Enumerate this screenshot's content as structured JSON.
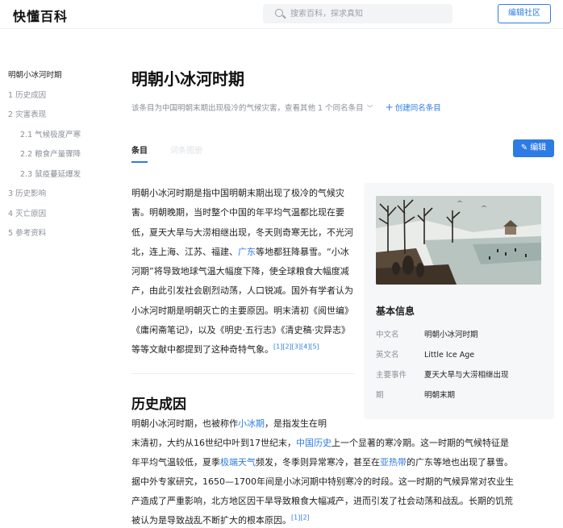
{
  "header": {
    "logo": "快懂百科",
    "search_placeholder": "搜索百科，探求真知",
    "edit_community": "编辑社区"
  },
  "toc": {
    "items": [
      {
        "label": "明朝小冰河时期",
        "active": true
      },
      {
        "label": "1 历史成因"
      },
      {
        "label": "2 灾害表现"
      },
      {
        "label": "2.1 气候极度严寒",
        "sub": true
      },
      {
        "label": "2.2 粮食产量骤降",
        "sub": true
      },
      {
        "label": "2.3 鼠疫蔓延爆发",
        "sub": true
      },
      {
        "label": "3 历史影响"
      },
      {
        "label": "4 灭亡原因"
      },
      {
        "label": "5 参考资料"
      }
    ]
  },
  "article": {
    "title": "明朝小冰河时期",
    "meta": "该条目为中国明朝末期出现极冷的气候灾害，查看其他 1 个同名条目",
    "create_same_name": "创建同名条目",
    "tab_active": "条目",
    "tab_faded": "词条图册",
    "edit_button": "编辑",
    "intro_parts": {
      "p1": "明朝小冰河时期是指中国明朝末期出现了极冷的气候灾害。明朝晚期，当时整个中国的年平均气温都比现在要低，夏天大旱与大涝相继出现，冬天则奇寒无比，不光河北，连上海、江苏、福建、",
      "link_guangdong": "广东",
      "p2": "等地都狂降暴雪。“小冰河期”将导致地球气温大幅度下降，使全球粮食大幅度减产，由此引发社会剧烈动荡，人口锐减。国外有学者认为小冰河时期是明朝灭亡的主要原因。明末清初《阅世编》《庸闲斋笔记》，以及《明史·五行志》《清史稿·灾异志》等等文献中都提到了这种奇特气象。",
      "refs": "[1][2][3][4][5]"
    },
    "section1_title": "历史成因",
    "section1": {
      "line1_a": "明朝小冰河时期，也被称作",
      "line1_link": "小冰期",
      "line1_b": "，是指发生在明",
      "line2_a": "末清初，大约从16世纪中叶到17世纪末，",
      "line2_link": "中国历史",
      "line2_b": "上一个显著的寒冷期。这一时期的气候特征是",
      "line3_a": "年平均气温较低，夏季",
      "line3_link1": "极端天气",
      "line3_b": "频发，冬季则异常寒冷，甚至在",
      "line3_link2": "亚热带",
      "line3_c": "的广东等地也出现了暴雪。",
      "line4": "据中外专家研究，1650—1700年间是小冰河期中特别寒冷的时段。这一时期的气候异常对农业生",
      "line5": "产造成了严重影响，北方地区因干旱导致粮食大幅减产，进而引发了社会动荡和战乱。长期的饥荒",
      "line6": "被认为是导致战乱不断扩大的根本原因。",
      "refs": "[1][2]"
    }
  },
  "infobox": {
    "title": "基本信息",
    "rows": [
      {
        "key": "中文名",
        "value": "明朝小冰河时期"
      },
      {
        "key": "英文名",
        "value": "Little Ice Age"
      },
      {
        "key": "主要事件",
        "value": "夏天大旱与大涝相继出现"
      },
      {
        "key": "期",
        "value": "明朝末期"
      }
    ]
  },
  "colors": {
    "accent": "#2d7be5",
    "muted": "#8a8f97",
    "infobox_bg": "#f6f7f9"
  }
}
